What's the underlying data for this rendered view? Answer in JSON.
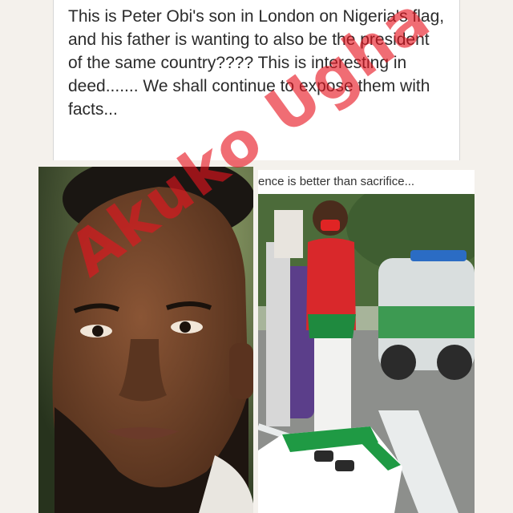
{
  "post": {
    "text": "This is Peter Obi's son in London on Nigeria's flag, and his father is wanting to also be the president of the same country???? This is interesting in deed....... We shall continue to expose them with facts..."
  },
  "right_photo": {
    "caption": "ence is better than sacrifice..."
  },
  "watermark": {
    "text": "Akuko Ugha"
  }
}
